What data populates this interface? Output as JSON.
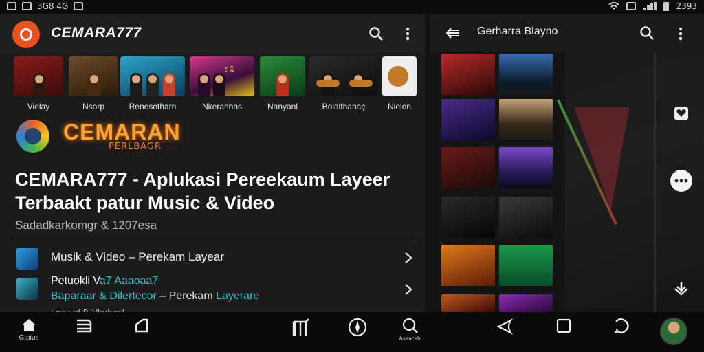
{
  "status_bar": {
    "left_text": "3G8 4G",
    "right_text": "2393"
  },
  "header": {
    "app_name": "CEMARA777"
  },
  "thumbnails": [
    {
      "caption": "Vielay"
    },
    {
      "caption": "Nsorp"
    },
    {
      "caption": "Renesotharn"
    },
    {
      "caption": "Nkeranhns"
    },
    {
      "caption": "Nanyanl"
    },
    {
      "caption": "Bolalthanaç"
    },
    {
      "caption": "Nielon"
    }
  ],
  "banner": {
    "title": "CEMARAN",
    "subtitle": "PERLBAGR"
  },
  "headline": "CEMARA777 - Aplukasi Pereekaum Layeer Terbaakt patur Music & Video",
  "meta": "Sadadkarkomgr & 1207esa",
  "list": {
    "item1": {
      "text": "Musik & Video – Perekam Layear"
    },
    "item2": {
      "line1_white": "Petuokli V",
      "line1_cyan": "a7 Aaaoaa7",
      "line2_cyan": "Baparaar & Dilertecor",
      "line2_white": " – Perekam ",
      "line2_end": "Layerare"
    },
    "item3_partial": "Lnaazd P. Vkuhacl"
  },
  "right_panel": {
    "title": "Gerharra Blayno"
  },
  "bottom_nav": {
    "home_label": "Gtoius",
    "search_label": "Aseaceb"
  },
  "colors": {
    "accent_orange": "#e8521e",
    "accent_cyan": "#35c6cf",
    "background": "#121212"
  }
}
